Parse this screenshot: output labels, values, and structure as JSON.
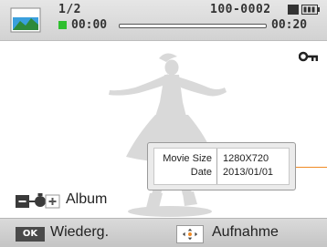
{
  "status_bar": {
    "file_counter": "1/2",
    "folder_file": "100-0002",
    "time_elapsed": "00:00",
    "time_total": "00:20",
    "playback_progress": 0.0,
    "icons": [
      "photo-thumbnail-icon",
      "memory-card-icon",
      "battery-icon",
      "play-indicator-icon"
    ]
  },
  "protect_icon": "key-icon",
  "info": {
    "movie_size_label": "Movie Size",
    "movie_size_value": "1280X720",
    "date_label": "Date",
    "date_value": "2013/01/01"
  },
  "zoom": {
    "icon": "zoom-control-icon",
    "label": "Album"
  },
  "bottom_bar": {
    "ok_key": "OK",
    "ok_action": "Wiederg.",
    "nav_icon": "navigation-pad-icon",
    "nav_action": "Aufnahme"
  },
  "colors": {
    "accent": "#f08a24",
    "play_indicator": "#2fbf2f",
    "bar_bg": "#d2d2d2"
  }
}
